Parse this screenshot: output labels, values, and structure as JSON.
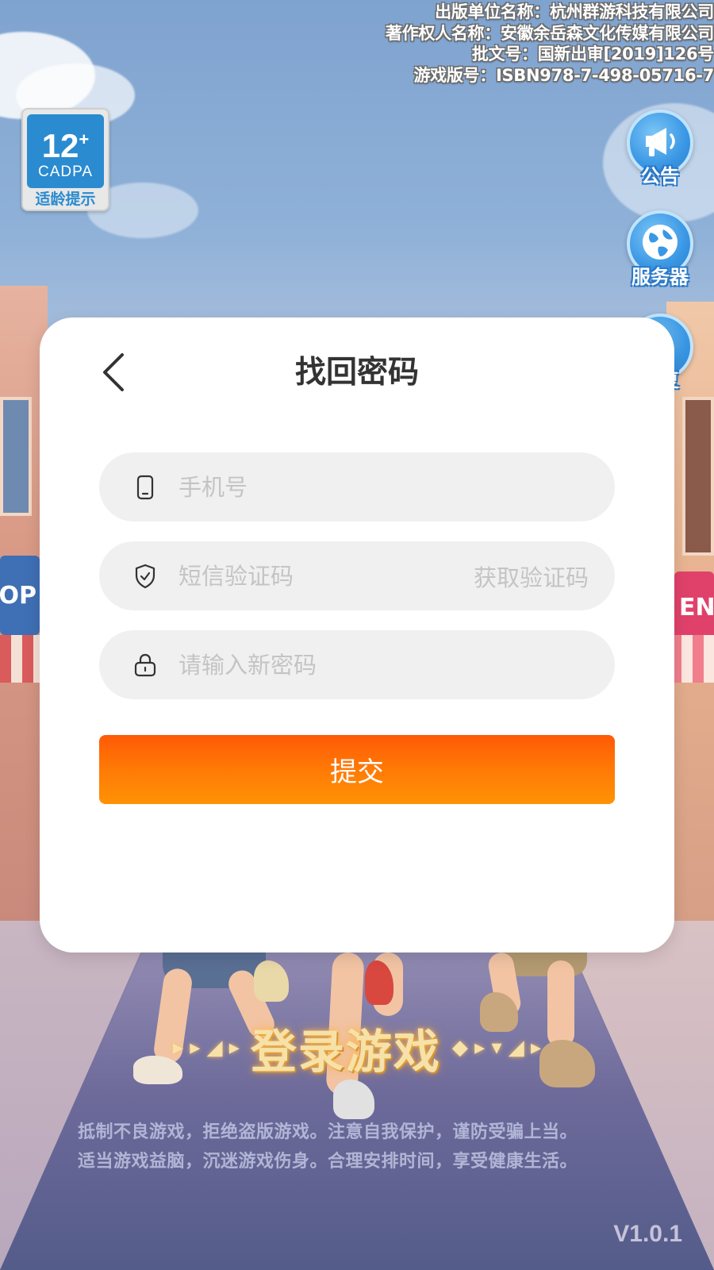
{
  "publication": {
    "line1": "出版单位名称：杭州群游科技有限公司",
    "line2": "著作权人名称：安徽余岳森文化传媒有限公司",
    "line3": "批文号：国新出审[2019]126号",
    "line4": "游戏版号：ISBN978-7-498-05716-7"
  },
  "age_badge": {
    "age": "12",
    "plus": "+",
    "org": "CADPA",
    "tip": "适龄提示"
  },
  "side_buttons": {
    "notice": "公告",
    "server": "服务器",
    "repair": "修复"
  },
  "modal": {
    "title": "找回密码",
    "phone_placeholder": "手机号",
    "sms_placeholder": "短信验证码",
    "get_code_label": "获取验证码",
    "password_placeholder": "请输入新密码",
    "submit_label": "提交"
  },
  "background": {
    "shop_sign_left": "OP",
    "shop_sign_right": "EN",
    "login_game_label": "登录游戏",
    "health_notice_line1": "抵制不良游戏，拒绝盗版游戏。注意自我保护，谨防受骗上当。",
    "health_notice_line2": "适当游戏益脑，沉迷游戏伤身。合理安排时间，享受健康生活。",
    "version": "V1.0.1"
  },
  "colors": {
    "accent_orange": "#ff6a06",
    "side_button_blue": "#3a97e4",
    "badge_blue": "#2a8bd0"
  },
  "icons": [
    "phone-icon",
    "shield-check-icon",
    "lock-icon",
    "back-chevron-icon",
    "megaphone-icon",
    "globe-icon",
    "wrench-check-icon"
  ]
}
